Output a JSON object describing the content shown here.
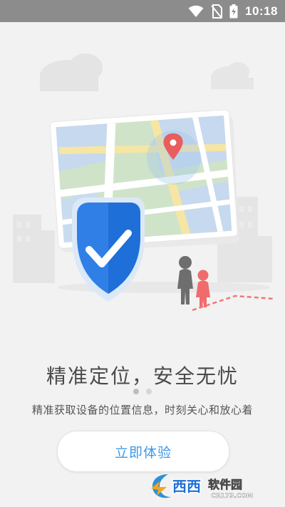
{
  "status_bar": {
    "time": "10:18",
    "icons": [
      "wifi-icon",
      "no-sim-icon",
      "battery-charging-icon"
    ]
  },
  "onboarding": {
    "headline": "精准定位，安全无忧",
    "subtitle": "精准获取设备的位置信息，时刻关心和放心着",
    "cta_label": "立即体验",
    "page_indicator": {
      "current": 1,
      "total": 2
    }
  },
  "watermark": {
    "brand": "西西软件园",
    "domain": "CR173.COM"
  },
  "colors": {
    "accent": "#3d9ae8",
    "pin": "#e85d5d",
    "shield": "#2f7fe6",
    "status_bar": "#8c8c8c",
    "background": "#f2f2f2"
  }
}
